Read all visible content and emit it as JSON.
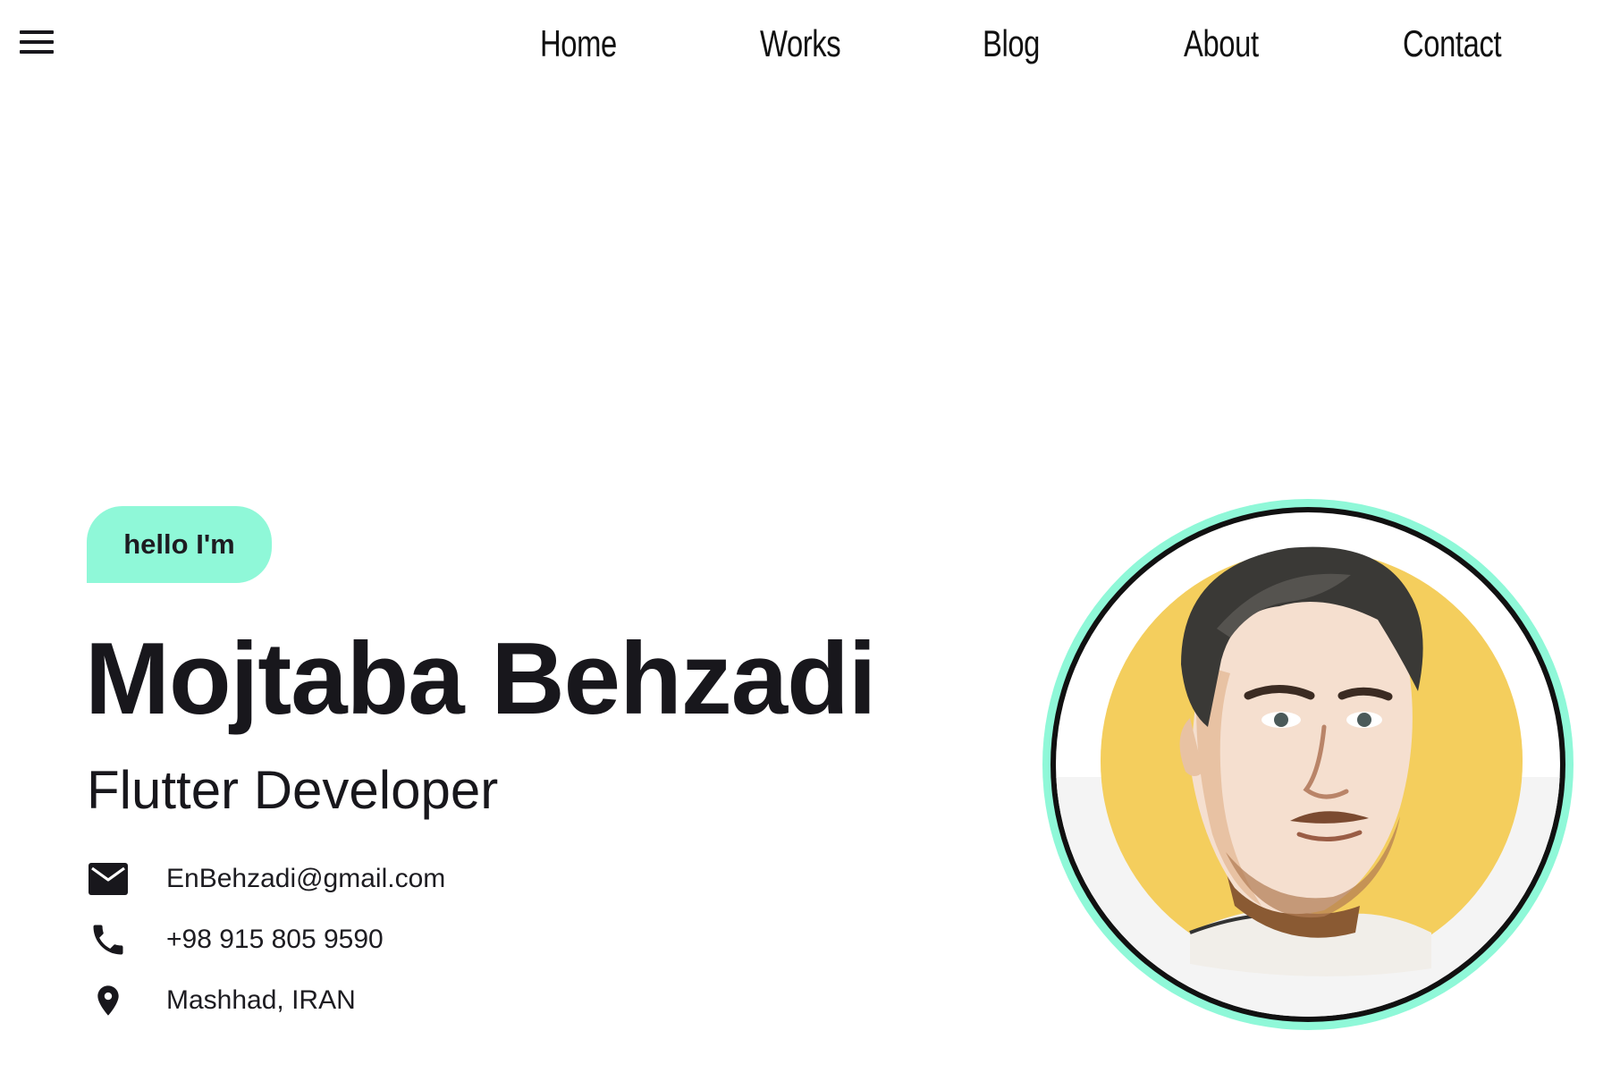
{
  "nav": {
    "menu_icon": "hamburger-menu-icon",
    "items": [
      {
        "label": "Home"
      },
      {
        "label": "Works"
      },
      {
        "label": "Blog"
      },
      {
        "label": "About"
      },
      {
        "label": "Contact"
      }
    ]
  },
  "hero": {
    "greeting": "hello I'm",
    "name": "Mojtaba Behzadi",
    "role": "Flutter Developer",
    "contacts": [
      {
        "icon": "mail-icon",
        "text": "EnBehzadi@gmail.com"
      },
      {
        "icon": "phone-icon",
        "text": "+98 915 805 9590"
      },
      {
        "icon": "location-pin-icon",
        "text": "Mashhad, IRAN"
      }
    ],
    "avatar_icon": "profile-portrait"
  },
  "colors": {
    "accent": "#8ff8d8",
    "text": "#18171c",
    "background": "#ffffff",
    "avatar_backdrop": "#f3c94e"
  }
}
